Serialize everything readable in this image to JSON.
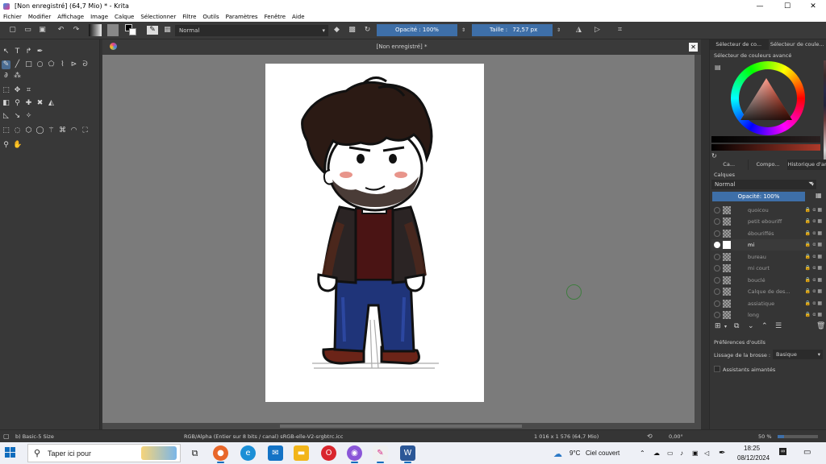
{
  "window": {
    "title": "[Non enregistré]  (64,7 Mio)  * - Krita",
    "minimize": "—",
    "maximize": "☐",
    "close": "✕"
  },
  "menu": [
    "Fichier",
    "Modifier",
    "Affichage",
    "Image",
    "Calque",
    "Sélectionner",
    "Filtre",
    "Outils",
    "Paramètres",
    "Fenêtre",
    "Aide"
  ],
  "toolbar": {
    "blend_mode": "Normal",
    "opacity": "Opacité : 100%",
    "size_label": "Taille :",
    "size_value": "72,57 px"
  },
  "canvas": {
    "tab_title": "[Non enregistré]  *",
    "close": "✕"
  },
  "docker": {
    "tabs_top": [
      "Sélecteur de co...",
      "Sélecteur de coule..."
    ],
    "selector_title": "Sélecteur de couleurs avancé",
    "tabs_mid": [
      "Ca...",
      "Compo...",
      "Historique d'annu..."
    ],
    "layers_title": "Calques",
    "layers_blend": "Normal",
    "layers_opacity": "Opacité:  100%",
    "layers": [
      {
        "name": "quoicou",
        "visible": false,
        "active": false
      },
      {
        "name": "petit ebouriff",
        "visible": false,
        "active": false
      },
      {
        "name": "ébouriffés",
        "visible": false,
        "active": false
      },
      {
        "name": "mi",
        "visible": true,
        "active": true
      },
      {
        "name": "bureau",
        "visible": false,
        "active": false
      },
      {
        "name": "mi court",
        "visible": false,
        "active": false
      },
      {
        "name": "bouclé",
        "visible": false,
        "active": false
      },
      {
        "name": "Calque de des...",
        "visible": false,
        "active": false
      },
      {
        "name": "assiatique",
        "visible": false,
        "active": false
      },
      {
        "name": "long",
        "visible": false,
        "active": false
      }
    ],
    "tool_options_title": "Préférences d'outils",
    "smoothing_label": "Lissage de la brosse :",
    "smoothing_value": "Basique",
    "magnetic_label": "Assistants aimantés"
  },
  "status": {
    "brush": "b) Basic-5 Size",
    "color_profile": "RGB/Alpha (Entier sur 8 bits / canal)  sRGB-elle-V2-srgbtrc.icc",
    "image_size": "1 016 x 1 576 (64,7 Mio)",
    "rotation": "0,00°",
    "zoom": "50 %"
  },
  "taskbar": {
    "search_placeholder": "Taper ici pour",
    "weather_temp": "9°C",
    "weather_desc": "Ciel couvert",
    "time": "18:25",
    "date": "08/12/2024"
  },
  "colors": {
    "accent": "#3e6fa8",
    "canvas_bg": "#7b7b7b",
    "panel_bg": "#353535"
  }
}
